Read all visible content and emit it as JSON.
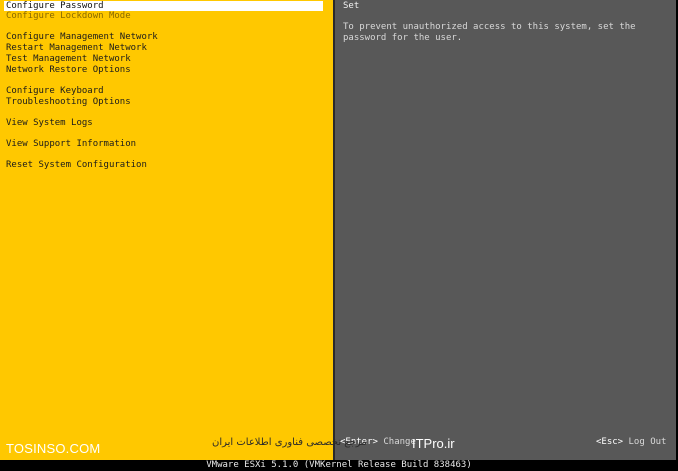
{
  "menu": {
    "items": [
      {
        "label": "Configure Password",
        "selected": true
      },
      {
        "label": "Configure Lockdown Mode",
        "disabled": true
      },
      {
        "label": "Configure Management Network"
      },
      {
        "label": "Restart Management Network"
      },
      {
        "label": "Test Management Network"
      },
      {
        "label": "Network Restore Options"
      },
      {
        "label": "Configure Keyboard"
      },
      {
        "label": "Troubleshooting Options"
      },
      {
        "label": "View System Logs"
      },
      {
        "label": "View Support Information"
      },
      {
        "label": "Reset System Configuration"
      }
    ]
  },
  "detail": {
    "title": "Set",
    "description": "To prevent unauthorized access to this system, set the password for the user."
  },
  "keys": {
    "enter_key": "<Enter>",
    "enter_action": "Change",
    "esc_key": "<Esc>",
    "esc_action": "Log Out"
  },
  "status_bar": "VMware ESXi 5.1.0 (VMKernel Release Build 838463)",
  "watermarks": {
    "left": "TOSINSO.COM",
    "middle": "مرجع تخصصی فناوری اطلاعات ایران",
    "right": "ITPro.ir"
  },
  "colors": {
    "menu_background": "#ffc800",
    "detail_background": "#585858",
    "selection": "#ffffff"
  }
}
